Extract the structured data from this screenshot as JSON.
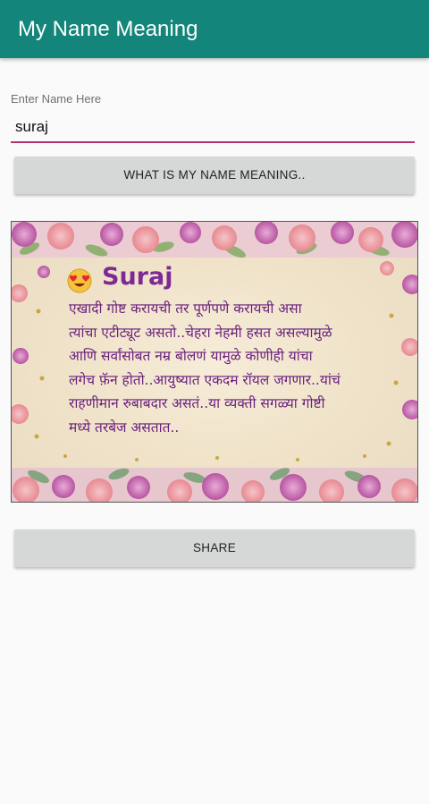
{
  "app_bar": {
    "title": "My Name Meaning"
  },
  "form": {
    "hint": "Enter Name Here",
    "name_value": "suraj",
    "meaning_button": "WHAT IS MY NAME MEANING.."
  },
  "card": {
    "name": "Suraj",
    "meaning": "एखादी गोष्ट करायची तर पूर्णपणे करायची असा\nत्यांचा एटीट्यूट असतो..चेहरा नेहमी हसत असल्यामुळे\nआणि सर्वांसोबत नम्र बोलणं यामुळे कोणीही यांचा\nलगेच फ़ॅन होतो..आयुष्यात एकदम रॉयल जगणार..यांचं\nराहणीमान रुबाबदार असतं..या व्यक्ती सगळ्या गोष्टी\nमध्ये तरबेज असतात..",
    "emoji_icon": "heart-eyes-emoji-icon",
    "colors": {
      "name": "#7e2a96",
      "text": "#6a1f7d",
      "background": "#f3e8d2"
    }
  },
  "actions": {
    "share_button": "SHARE"
  },
  "theme": {
    "primary": "#13857a",
    "accent": "#b3336a",
    "button_bg": "#d6d7d7"
  }
}
